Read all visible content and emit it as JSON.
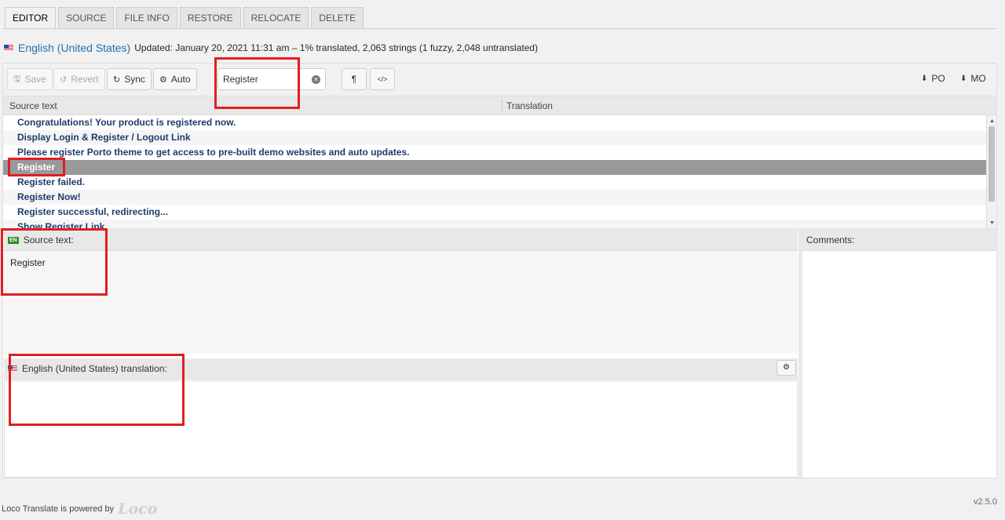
{
  "tabs": [
    "EDITOR",
    "SOURCE",
    "FILE INFO",
    "RESTORE",
    "RELOCATE",
    "DELETE"
  ],
  "header": {
    "locale_name": "English (United States)",
    "meta": "Updated: January 20, 2021 11:31 am – 1% translated, 2,063 strings (1 fuzzy, 2,048 untranslated)"
  },
  "toolbar": {
    "save": "Save",
    "revert": "Revert",
    "sync": "Sync",
    "auto": "Auto",
    "search_value": "Register",
    "pilcrow": "¶",
    "code": "</>",
    "po": "PO",
    "mo": "MO"
  },
  "list": {
    "col_source": "Source text",
    "col_translation": "Translation",
    "rows": [
      "Congratulations! Your product is registered now.",
      "Display Login & Register / Logout Link",
      "Please register Porto theme to get access to pre-built demo websites and auto updates.",
      "Register",
      "Register failed.",
      "Register Now!",
      "Register successful, redirecting...",
      "Show Register Link"
    ]
  },
  "source_pane": {
    "badge": "EN",
    "title": "Source text:",
    "text": "Register"
  },
  "translation_pane": {
    "title": "English (United States) translation:"
  },
  "comments_pane": {
    "title": "Comments:"
  },
  "footer": {
    "powered": "Loco Translate is powered by",
    "logo": "Loco",
    "version": "v2.5.0"
  },
  "colors": {
    "highlight": "#e21d24",
    "selected_row": "#999999",
    "row_text": "#1d3c6c",
    "link": "#2271b1"
  }
}
